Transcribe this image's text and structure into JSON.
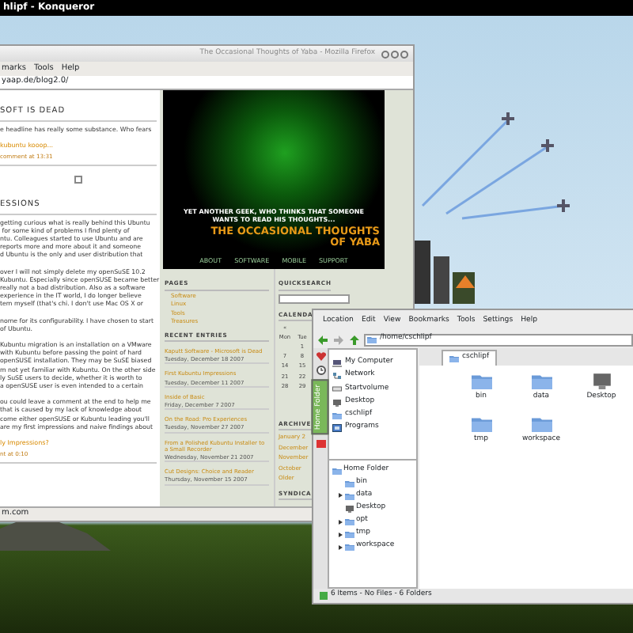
{
  "top_bar": {
    "title": "hlipf - Konqueror"
  },
  "firefox": {
    "title": "The Occasional Thoughts of Yaba - Mozilla Firefox",
    "menu": [
      "marks",
      "Tools",
      "Help"
    ],
    "url": "yaap.de/blog2.0/",
    "posts": [
      {
        "kind": "heading",
        "text": "SOFT IS DEAD"
      },
      {
        "kind": "paragraph",
        "text": "e headline has really some substance. Who fears"
      },
      {
        "kind": "link",
        "text": "kubuntu kooop..."
      },
      {
        "kind": "meta",
        "text": "comment at 13:31"
      },
      {
        "kind": "icon"
      },
      {
        "kind": "heading",
        "text": "ESSIONS"
      },
      {
        "kind": "paragraph",
        "text": "getting curious what is really behind this Ubuntu\n for some kind of problems I find plenty of\nntu. Colleagues started to use Ubuntu and are\nreports more and more about it and someone\nd Ubuntu is the only and user distribution that"
      },
      {
        "kind": "paragraph",
        "text": "over I will not simply delete my openSuSE 10.2\nKubuntu. Especially since openSUSE became better\nreally not a bad distribution. Also as a software\nexperience in the IT world, I do longer believe\ntem myself (that's chi. I don't use Mac OS X or"
      },
      {
        "kind": "paragraph",
        "text": "nome for its configurability. I have chosen to start\nof Ubuntu."
      },
      {
        "kind": "paragraph",
        "text": "Kubuntu migration is an installation on a VMware\nwith Kubuntu before passing the point of hard\nopenSUSE installation. They may be SuSE biased\nm not yet familiar with Kubuntu. On the other side\nly SuSE users to decide, whether it is worth to\na openSUSE user is even intended to a certain"
      },
      {
        "kind": "paragraph",
        "text": "ou could leave a comment at the end to help me\nthat is caused by my lack of knowledge about\ncome either openSUSE or Kubuntu leading you'll\nare my first impressions and naive findings about"
      },
      {
        "kind": "link",
        "text": "ly Impressions?"
      },
      {
        "kind": "meta",
        "text": "nt at 0:10"
      }
    ],
    "header": {
      "tagline": "YET ANOTHER GEEK, WHO THINKS THAT SOMEONE\nWANTS TO READ HIS THOUGHTS...",
      "title": "THE OCCASIONAL THOUGHTS\nOF YABA",
      "nav": [
        "ABOUT",
        "SOFTWARE",
        "MOBILE",
        "SUPPORT"
      ]
    },
    "pages": {
      "heading": "PAGES",
      "links": [
        "Software",
        "Linux",
        "Tools",
        "Treasures"
      ]
    },
    "recent": {
      "heading": "RECENT ENTRIES",
      "entries": [
        {
          "title": "Kaputt Software - Microsoft is Dead",
          "date": "Tuesday, December 18 2007"
        },
        {
          "title": "First Kubuntu Impressions",
          "date": "Tuesday, December 11 2007"
        },
        {
          "title": "Inside of Basic",
          "date": "Friday, December 7 2007"
        },
        {
          "title": "On the Road: Pro Experiences",
          "date": "Tuesday, November 27 2007"
        },
        {
          "title": "From a Polished Kubuntu Installer to a Small Recorder",
          "date": "Wednesday, November 21 2007"
        },
        {
          "title": "Cut Designs: Choice and Reader",
          "date": "Thursday, November 15 2007"
        }
      ]
    },
    "quicksearch": {
      "heading": "QUICKSEARCH"
    },
    "calendar": {
      "heading": "CALENDA",
      "nav": "«",
      "days": [
        "Mon",
        "Tue"
      ],
      "weeks": [
        {
          "tue": "1"
        },
        {
          "mon": "7",
          "tue": "8"
        },
        {
          "mon": "14",
          "tue": "15"
        },
        {
          "mon": "21",
          "tue": "22"
        },
        {
          "mon": "28",
          "tue": "29"
        }
      ]
    },
    "archives": {
      "heading": "ARCHIVE",
      "links": [
        "January 2",
        "December",
        "November",
        "October",
        "Older"
      ]
    },
    "syndicate": {
      "heading": "SYNDICA"
    },
    "status": "m.com"
  },
  "konqueror": {
    "menu": [
      "Location",
      "Edit",
      "View",
      "Bookmarks",
      "Tools",
      "Settings",
      "Help"
    ],
    "location": "/home/cschlipf",
    "side_tabs": [
      {
        "label": "Home Folder",
        "selected": true
      }
    ],
    "places": [
      {
        "label": "My Computer",
        "kind": "computer"
      },
      {
        "label": "Network",
        "kind": "network"
      },
      {
        "label": "Startvolume",
        "kind": "drive"
      },
      {
        "label": "Desktop",
        "kind": "desktop"
      },
      {
        "label": "cschlipf",
        "kind": "folder"
      },
      {
        "label": "Programs",
        "kind": "programs"
      }
    ],
    "tree": {
      "label": "Home Folder",
      "children": [
        {
          "label": "bin",
          "expandable": false,
          "kind": "folder"
        },
        {
          "label": "data",
          "expandable": true,
          "kind": "folder"
        },
        {
          "label": "Desktop",
          "expandable": false,
          "kind": "desktop"
        },
        {
          "label": "opt",
          "expandable": true,
          "kind": "folder"
        },
        {
          "label": "tmp",
          "expandable": true,
          "kind": "folder"
        },
        {
          "label": "workspace",
          "expandable": true,
          "kind": "folder"
        }
      ]
    },
    "tab": "cschlipf",
    "files": [
      {
        "name": "bin",
        "kind": "folder"
      },
      {
        "name": "data",
        "kind": "folder"
      },
      {
        "name": "Desktop",
        "kind": "desktop"
      },
      {
        "name": "tmp",
        "kind": "folder"
      },
      {
        "name": "workspace",
        "kind": "folder"
      }
    ],
    "status": "6 Items - No Files - 6 Folders"
  }
}
